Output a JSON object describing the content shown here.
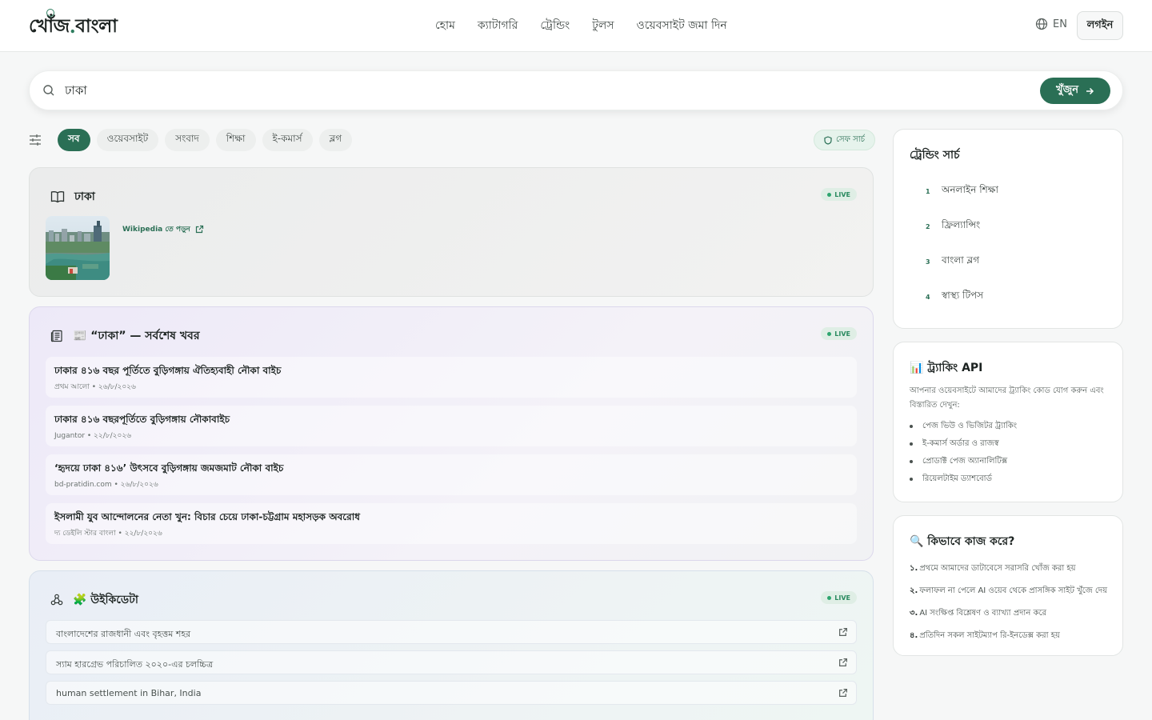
{
  "header": {
    "logo_main": "খোঁজ",
    "logo_dot": ".",
    "logo_suffix": "বাংলা",
    "nav": [
      "হোম",
      "ক্যাটাগরি",
      "ট্রেন্ডিং",
      "টুলস",
      "ওয়েবসাইট জমা দিন"
    ],
    "lang": "EN",
    "login": "লগইন"
  },
  "search": {
    "value": "ঢাকা",
    "button": "খুঁজুন"
  },
  "filters": {
    "chips": [
      "সব",
      "ওয়েবসাইট",
      "সংবাদ",
      "শিক্ষা",
      "ই-কমার্স",
      "ব্লগ"
    ],
    "active": "সব",
    "safe_search": "সেফ সার্চ"
  },
  "wiki_card": {
    "title": "ঢাকা",
    "live": "LIVE",
    "link": "Wikipedia তে পড়ুন"
  },
  "news_card": {
    "title": "📰 “ঢাকা” — সর্বশেষ খবর",
    "live": "LIVE",
    "items": [
      {
        "title": "ঢাকার ৪১৬ বছর পূর্তিতে বুড়িগঙ্গায় ঐতিহ্যবাহী নৌকা বাইচ",
        "meta": "প্রথম আলো • ২৬/৮/২০২৬"
      },
      {
        "title": "ঢাকার ৪১৬ বছরপূর্তিতে বুড়িগঙ্গায় নৌকাবাইচ",
        "meta": "Jugantor • ২২/৮/২০২৬"
      },
      {
        "title": "‘হৃদয়ে ঢাকা ৪১৬’ উৎসবে বুড়িগঙ্গায় জমজমাট নৌকা বাইচ",
        "meta": "bd-pratidin.com • ২৬/৮/২০২৬"
      },
      {
        "title": "ইসলামী যুব আন্দোলনের নেতা খুন: বিচার চেয়ে ঢাকা-চট্টগ্রাম মহাসড়ক অবরোধ",
        "meta": "দ্য ডেইলি স্টার বাংলা • ২২/৮/২০২৬"
      }
    ]
  },
  "wikidata_card": {
    "title": "🧩 উইকিডেটা",
    "live": "LIVE",
    "items": [
      "বাংলাদেশের রাজধানী এবং বৃহত্তম শহর",
      "স্যাম হারগ্রেভ পরিচালিত ২০২০-এর চলচ্চিত্র",
      "human settlement in Bihar, India"
    ]
  },
  "trending": {
    "title": "ট্রেন্ডিং সার্চ",
    "items": [
      {
        "num": "1",
        "label": "অনলাইন শিক্ষা"
      },
      {
        "num": "2",
        "label": "ফ্রিল্যান্সিং"
      },
      {
        "num": "3",
        "label": "বাংলা ব্লগ"
      },
      {
        "num": "4",
        "label": "স্বাস্থ্য টিপস"
      }
    ]
  },
  "api": {
    "title": "📊 ট্র্যাকিং API",
    "desc": "আপনার ওয়েবসাইটে আমাদের ট্র্যাকিং কোড যোগ করুন এবং বিস্তারিত দেখুন:",
    "items": [
      "পেজ ভিউ ও ভিজিটর ট্র্যাকিং",
      "ই-কমার্স অর্ডার ও রাজস্ব",
      "প্রোডাক্ট পেজ অ্যানালিটিক্স",
      "রিয়েলটাইম ড্যাশবোর্ড"
    ]
  },
  "how": {
    "title": "🔍 কিভাবে কাজ করে?",
    "items": [
      {
        "n": "১.",
        "text": "প্রথমে আমাদের ডাটাবেসে সরাসরি খোঁজ করা হয়"
      },
      {
        "n": "২.",
        "text": "ফলাফল না পেলে AI ওয়েব থেকে প্রাসঙ্গিক সাইট খুঁজে দেয়"
      },
      {
        "n": "৩.",
        "text": "AI সংক্ষিপ্ত বিশ্লেষণ ও ব্যাখ্যা প্রদান করে"
      },
      {
        "n": "৪.",
        "text": "প্রতিদিন সকল সাইটম্যাপ রি-ইনডেক্স করা হয়"
      }
    ]
  },
  "colors": {
    "accent": "#2a6f55",
    "live": "#2ea56f"
  }
}
